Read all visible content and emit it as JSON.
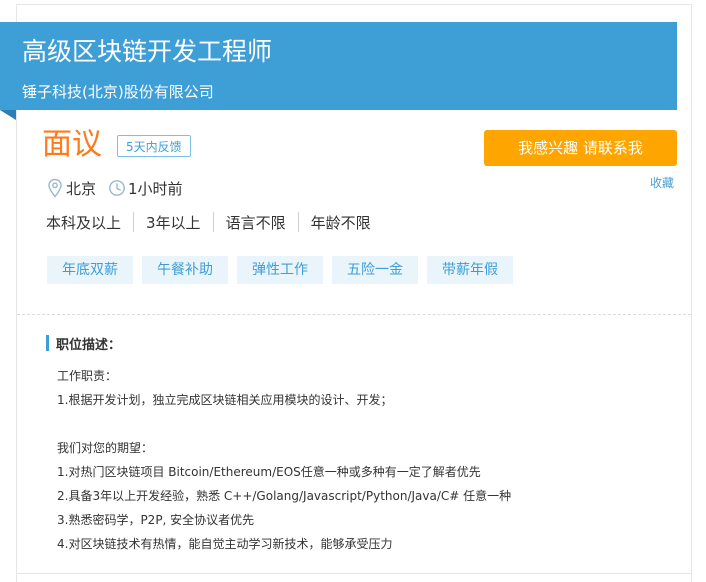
{
  "job": {
    "title": "高级区块链开发工程师",
    "company": "锤子科技(北京)股份有限公司",
    "salary": "面议",
    "feedback_badge": "5天内反馈",
    "apply_label": "我感兴趣 请联系我",
    "collect_label": "收藏",
    "location": "北京",
    "posted": "1小时前",
    "requirements": [
      "本科及以上",
      "3年以上",
      "语言不限",
      "年龄不限"
    ],
    "benefits": [
      "年底双薪",
      "午餐补助",
      "弹性工作",
      "五险一金",
      "带薪年假"
    ]
  },
  "description": {
    "heading": "职位描述：",
    "lines": [
      "工作职责：",
      "1.根据开发计划，独立完成区块链相关应用模块的设计、开发；",
      "",
      "我们对您的期望：",
      "1.对热门区块链项目 Bitcoin/Ethereum/EOS任意一种或多种有一定了解者优先",
      "2.具备3年以上开发经验，熟悉 C++/Golang/Javascript/Python/Java/C# 任意一种",
      "3.熟悉密码学，P2P, 安全协议者优先",
      "4.对区块链技术有热情，能自觉主动学习新技术，能够承受压力"
    ]
  },
  "colors": {
    "banner": "#3e9ed6",
    "salary": "#ff7a1a",
    "apply_button": "#ffa500",
    "tag_bg": "#eaf5fb"
  },
  "icons": {
    "location": "map-pin-icon",
    "time": "clock-icon"
  }
}
